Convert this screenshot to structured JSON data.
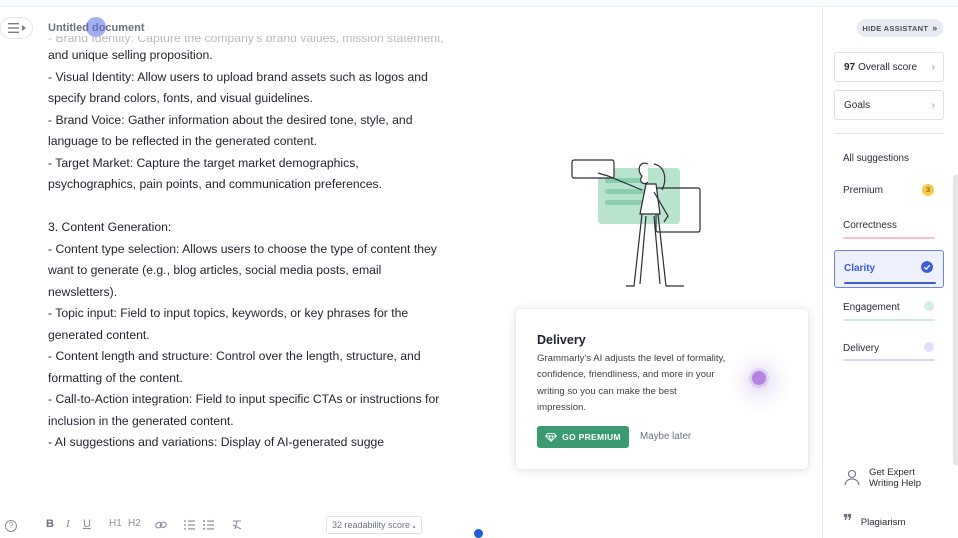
{
  "document": {
    "title": "Untitled document",
    "lines": [
      {
        "text": "- Brand Identity: Capture the company's brand values, mission statement,",
        "style": "faded"
      },
      {
        "text": "and unique selling proposition.",
        "style": "normal"
      },
      {
        "text": "- Visual Identity: Allow users to upload brand assets such as logos and",
        "style": "normal"
      },
      {
        "text": "specify brand colors, fonts, and visual guidelines.",
        "style": "normal"
      },
      {
        "text": "- Brand Voice: Gather information about the desired tone, style, and",
        "style": "normal"
      },
      {
        "text": "language to be reflected in the generated content.",
        "style": "normal"
      },
      {
        "text": "- Target Market: Capture the target market demographics,",
        "style": "normal"
      },
      {
        "text": "psychographics, pain points, and communication preferences.",
        "style": "normal"
      },
      {
        "text": "",
        "style": "blank"
      },
      {
        "text": "3. Content Generation:",
        "style": "normal"
      },
      {
        "text": "- Content type selection: Allows users to choose the type of content they",
        "style": "normal"
      },
      {
        "text": "want to generate (e.g., blog articles, social media posts, email",
        "style": "normal"
      },
      {
        "text": "newsletters).",
        "style": "normal"
      },
      {
        "text": "- Topic input: Field to input topics, keywords, or key phrases for the",
        "style": "normal"
      },
      {
        "text": "generated content.",
        "style": "normal"
      },
      {
        "text": "- Content length and structure: Control over the length, structure, and",
        "style": "normal"
      },
      {
        "text": "formatting of the content.",
        "style": "normal"
      },
      {
        "text": "- Call-to-Action integration: Field to input specific CTAs or instructions for",
        "style": "normal"
      },
      {
        "text": "inclusion in the generated content.",
        "style": "normal"
      },
      {
        "text": "- AI suggestions and variations: Display of AI-generated sugge",
        "style": "normal"
      }
    ]
  },
  "toolbar": {
    "bold": "B",
    "italic": "I",
    "underline": "U",
    "h1": "H1",
    "h2": "H2",
    "readability": "32 readability score"
  },
  "card": {
    "title": "Delivery",
    "body": "Grammarly's AI adjusts the level of formality, confidence, friendliness, and more in your writing so you can make the best impression.",
    "premium_label": "GO PREMIUM",
    "maybe_label": "Maybe later"
  },
  "assistant": {
    "hide_label": "HIDE ASSISTANT",
    "overall_score": "97",
    "overall_label": "Overall score",
    "goals_label": "Goals",
    "all_suggestions": "All suggestions",
    "categories": [
      {
        "label": "Premium",
        "badge": "3",
        "color": "#f5cb47"
      },
      {
        "label": "Correctness",
        "color": "#e8707b"
      },
      {
        "label": "Clarity",
        "color": "#3b5bdb"
      },
      {
        "label": "Engagement",
        "color": "#3a9a72"
      },
      {
        "label": "Delivery",
        "color": "#8b6ee0"
      }
    ],
    "expert_label": "Get Expert Writing Help",
    "plagiarism_label": "Plagiarism"
  }
}
